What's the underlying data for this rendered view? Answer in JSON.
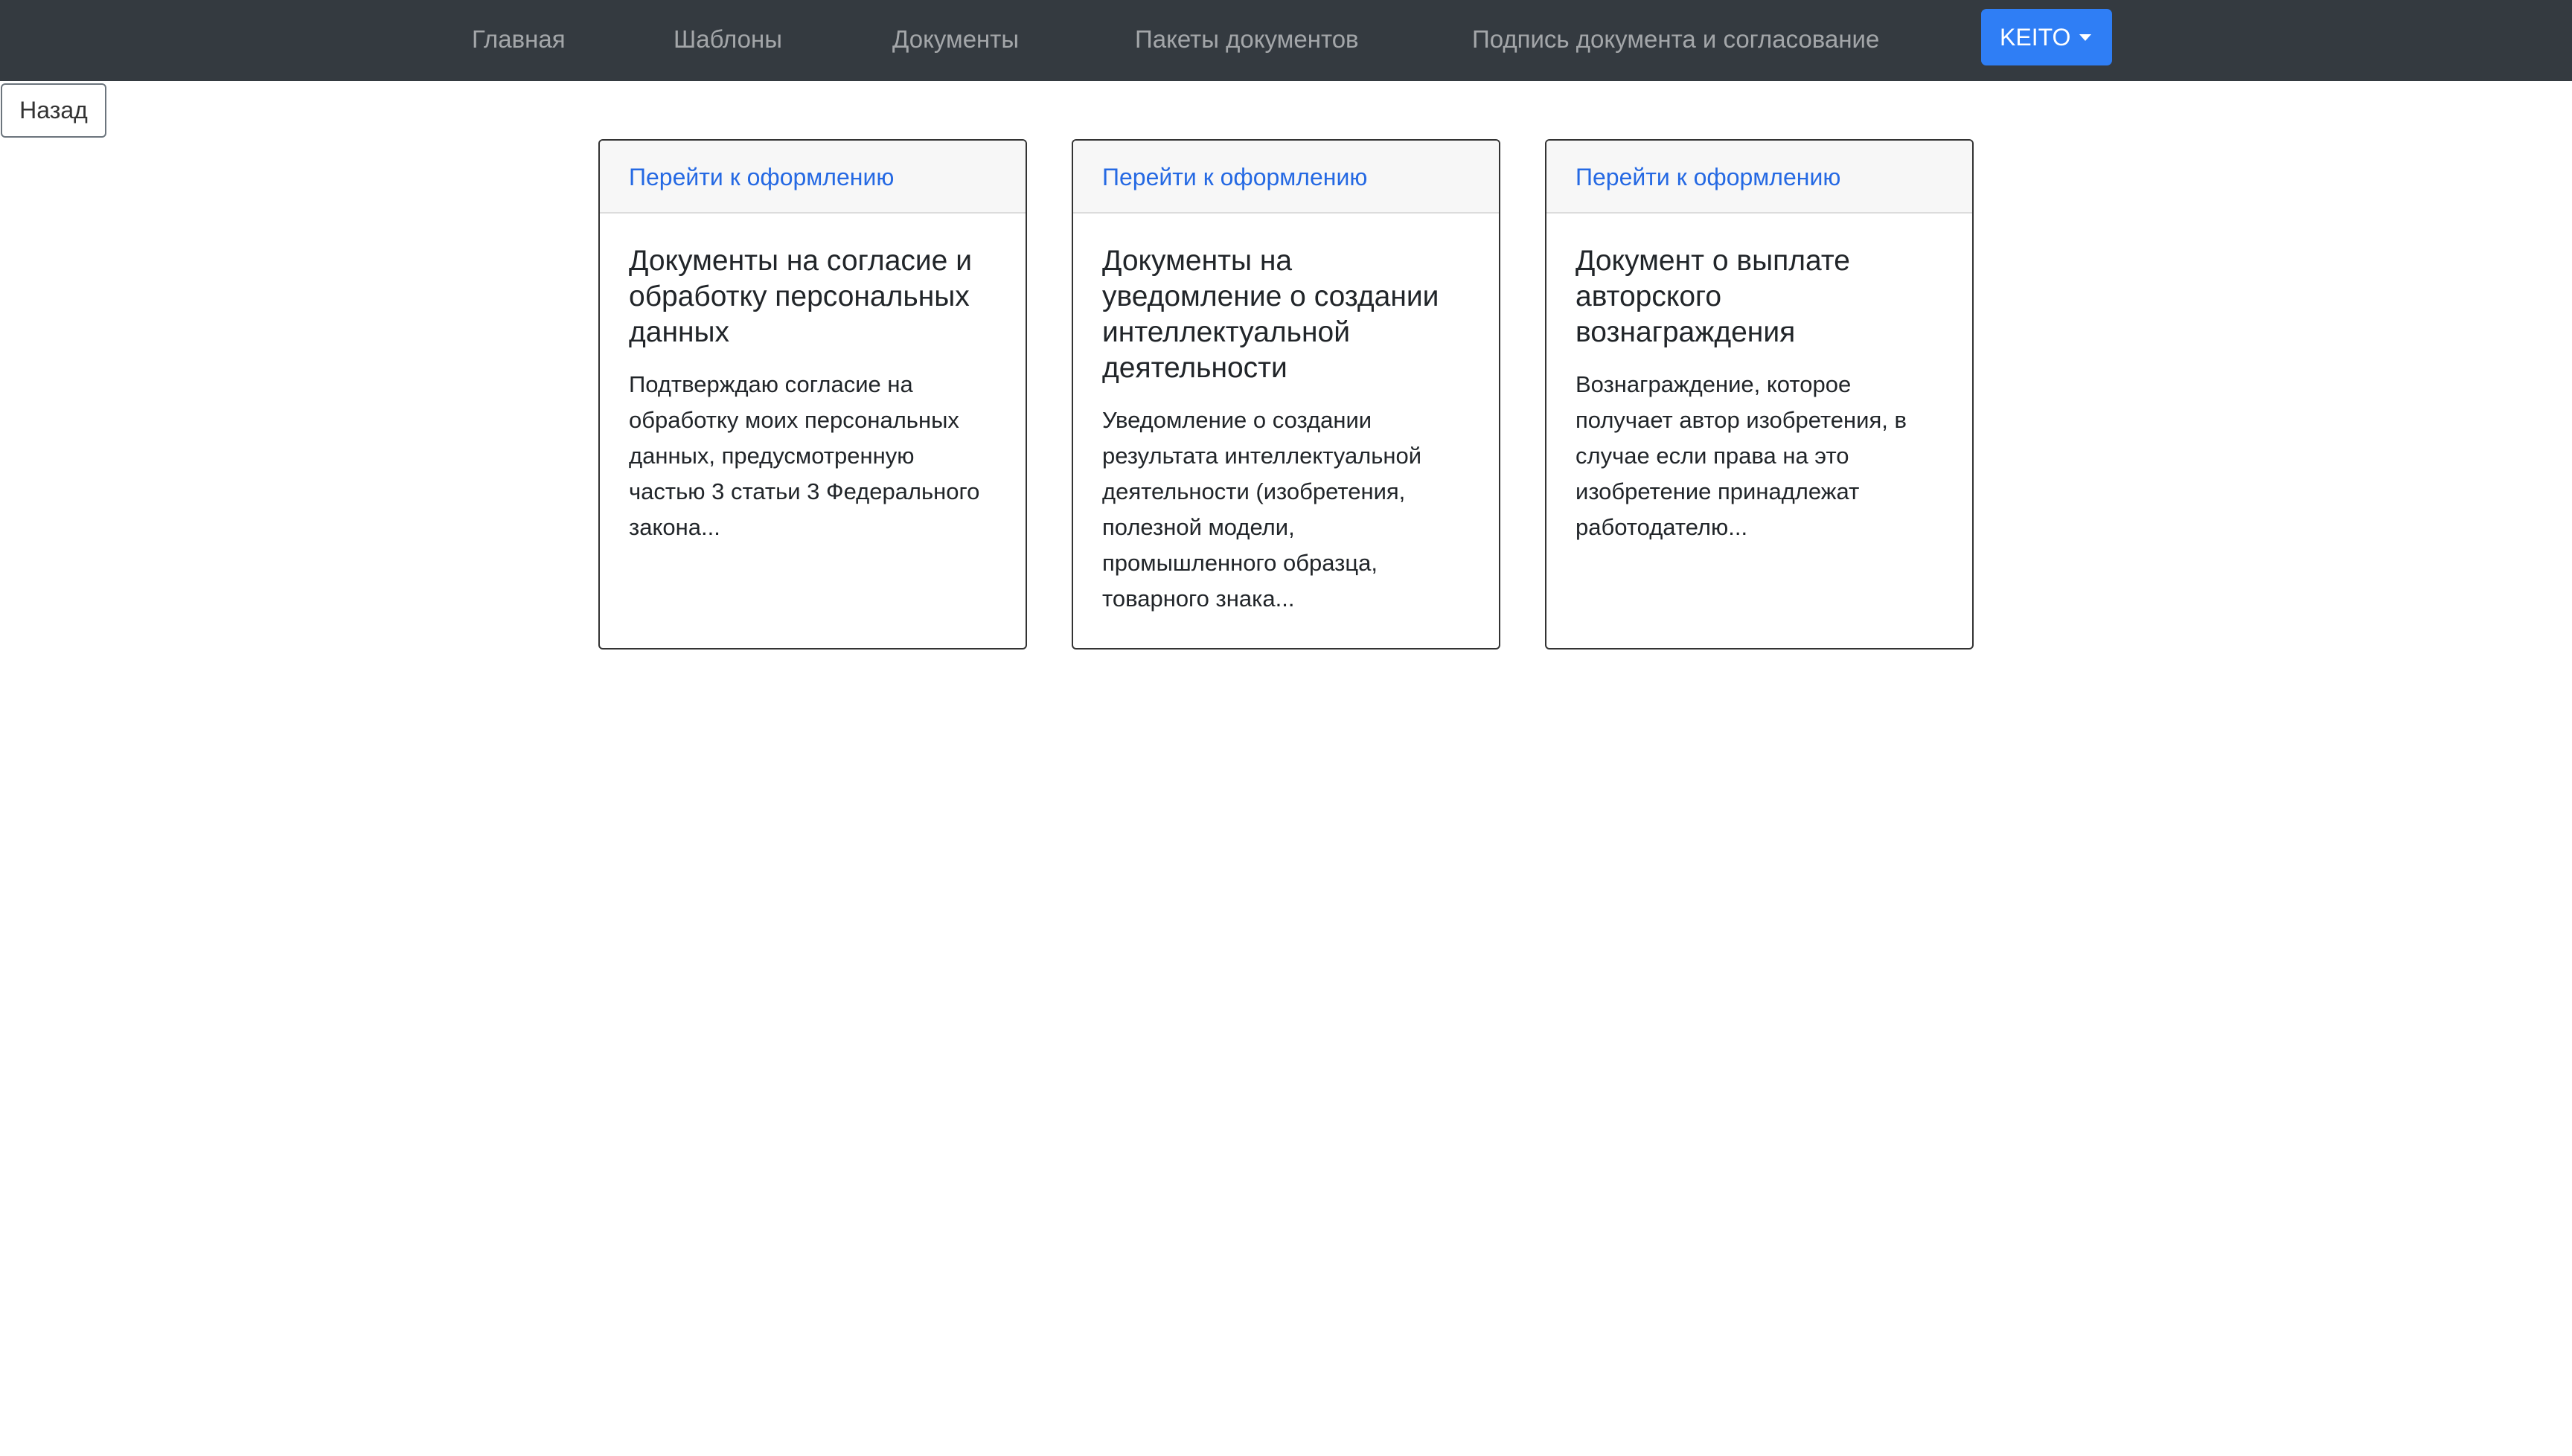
{
  "nav": {
    "items": [
      {
        "label": "Главная"
      },
      {
        "label": "Шаблоны"
      },
      {
        "label": "Документы"
      },
      {
        "label": "Пакеты документов"
      },
      {
        "label": "Подпись документа и согласование"
      }
    ],
    "user_button": "KEITO"
  },
  "back_label": "Назад",
  "cards": [
    {
      "link": "Перейти к оформлению",
      "title": "Документы на согласие и обработку персональных данных",
      "text": "Подтверждаю согласие на обработку моих персональных данных, предусмотренную частью 3 статьи 3 Федерального закона..."
    },
    {
      "link": "Перейти к оформлению",
      "title": "Документы на уведомление о создании интеллектуальной деятельности",
      "text": "Уведомление о создании результата интеллектуальной деятельности (изобретения, полезной модели, промышленного образца, товарного знака..."
    },
    {
      "link": "Перейти к оформлению",
      "title": "Документ о выплате авторского вознаграждения",
      "text": "Вознаграждение, которое получает автор изобретения, в случае если права на это изобретение принадлежат работодателю..."
    }
  ]
}
